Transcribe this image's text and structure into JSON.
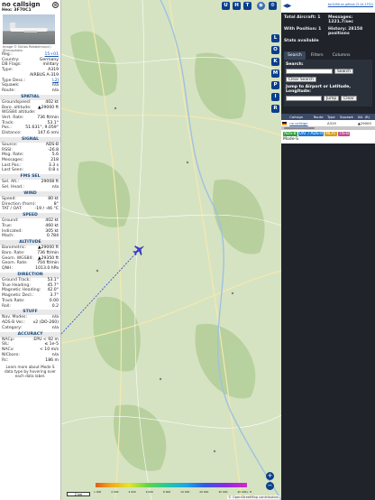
{
  "aircraft": {
    "callsign": "no callsign",
    "hex_label": "Hex:",
    "hex": "3F70C1",
    "photo_credit": "Image © Niclas Rebbelmund / @nrcaphoto",
    "close_symbol": "⊗"
  },
  "info_rows": [
    {
      "k": "Reg.:",
      "v": "15+01",
      "link": true
    },
    {
      "k": "Country:",
      "v": "Germany"
    },
    {
      "k": "DB Flags:",
      "v": "military"
    },
    {
      "k": "Type:",
      "v": "A319"
    },
    {
      "k": "",
      "v": "AIRBUS A-319"
    },
    {
      "k": "Type Desc.:",
      "v": "L2J",
      "link": true
    },
    {
      "k": "Squawk:",
      "v": "n/a"
    },
    {
      "k": "Route:",
      "v": "n/a"
    }
  ],
  "sections": [
    {
      "title": "SPATIAL",
      "rows": [
        {
          "k": "Groundspeed:",
          "v": "402 kt"
        },
        {
          "k": "Baro. altitude:",
          "v": "▲29000 ft"
        },
        {
          "k": "WGS84 altitude:",
          "v": ""
        },
        {
          "k": "Vert. Rate:",
          "v": "736 ft/min"
        },
        {
          "k": "Track:",
          "v": "53.1°"
        },
        {
          "k": "Pos.:",
          "v": "51.631°, 9.059°"
        },
        {
          "k": "Distance:",
          "v": "147.6 nmi"
        }
      ]
    },
    {
      "title": "SIGNAL",
      "rows": [
        {
          "k": "Source:",
          "v": "ADS-B"
        },
        {
          "k": "RSSI:",
          "v": "-26.8"
        },
        {
          "k": "Msg. Rate:",
          "v": "5.6"
        },
        {
          "k": "Messages:",
          "v": "218"
        },
        {
          "k": "Last Pos.:",
          "v": "3.3 s"
        },
        {
          "k": "Last Seen:",
          "v": "0.8 s"
        }
      ]
    },
    {
      "title": "FMS SEL",
      "rows": [
        {
          "k": "Sel. Alt.:",
          "v": "29008 ft"
        },
        {
          "k": "Sel. Head.:",
          "v": "n/a"
        }
      ]
    },
    {
      "title": "WIND",
      "rows": [
        {
          "k": "Speed:",
          "v": "80 kt"
        },
        {
          "k": "Direction (from):",
          "v": "8°"
        },
        {
          "k": "TAT / OAT:",
          "v": "-19 / -46 °C"
        }
      ]
    },
    {
      "title": "SPEED",
      "rows": [
        {
          "k": "Ground:",
          "v": "402 kt"
        },
        {
          "k": "True:",
          "v": "460 kt"
        },
        {
          "k": "Indicated:",
          "v": "305 kt"
        },
        {
          "k": "Mach:",
          "v": "0.784"
        }
      ]
    },
    {
      "title": "ALTITUDE",
      "rows": [
        {
          "k": "Barometric:",
          "v": "▲29000 ft"
        },
        {
          "k": "Baro. Rate:",
          "v": "736 ft/min"
        },
        {
          "k": "Geom. WGS84:",
          "v": "▲29350 ft"
        },
        {
          "k": "Geom. Rate:",
          "v": "704 ft/min"
        },
        {
          "k": "QNH:",
          "v": "1013.0 hPa"
        }
      ]
    },
    {
      "title": "DIRECTION",
      "rows": [
        {
          "k": "Ground Track:",
          "v": "53.1°"
        },
        {
          "k": "True Heading:",
          "v": "45.7°"
        },
        {
          "k": "Magnetic Heading:",
          "v": "42.0°"
        },
        {
          "k": "Magnetic Decl.:",
          "v": "3.7°"
        },
        {
          "k": "Track Rate:",
          "v": "0.00"
        },
        {
          "k": "Roll:",
          "v": "0.2"
        }
      ]
    },
    {
      "title": "STUFF",
      "rows": [
        {
          "k": "Nav. Modes:",
          "v": "n/a"
        },
        {
          "k": "ADS-B Ver.:",
          "v": "v2 (DO-260)"
        },
        {
          "k": "Category:",
          "v": "n/a"
        }
      ]
    },
    {
      "title": "ACCURACY",
      "rows": [
        {
          "k": "NACp:",
          "v": "EPU < 92 m"
        },
        {
          "k": "SIL:",
          "v": "≤ 1e-5"
        },
        {
          "k": "NACv:",
          "v": "< 10 m/s"
        },
        {
          "k": "NICbaro:",
          "v": "n/a"
        },
        {
          "k": "Rc:",
          "v": "186 m"
        }
      ]
    }
  ],
  "footer_note": "Learn more about Mode S data type by hovering over each data label.",
  "map": {
    "top_buttons": [
      "U",
      "H",
      "T"
    ],
    "side_buttons": [
      "L",
      "O",
      "K",
      "M",
      "P",
      "I",
      "R"
    ],
    "scale_label": "2 km",
    "altitude_legend": [
      "1 000",
      "2 000",
      "4 000",
      "6 000",
      "8 000",
      "10 000",
      "20 000",
      "30 000",
      "40 000+ ft"
    ],
    "attribution": "© OpenStreetMap contributors",
    "zoom_in": "+",
    "zoom_out": "−"
  },
  "right": {
    "download_link": "tar1090 on github (3.14.1752)",
    "stats": [
      {
        "label": "Total Aircraft: 1",
        "value": "Messages: 1221.7/sec"
      },
      {
        "label": "With Position: 1",
        "value": "History: 28158 positions"
      },
      {
        "label": "Stats available",
        "value": ""
      }
    ],
    "tabs": [
      "Search",
      "Filters",
      "Columns"
    ],
    "search_label": "Search:",
    "search_button": "Search",
    "clear_search": "Clear Search",
    "jump_label": "Jump to Airport or Latitude, Longitude:",
    "jump_button": "Jump",
    "clear_button": "Clear",
    "table_headers": [
      "",
      "Callsign",
      "Route",
      "Type",
      "Squawk",
      "Alt. (ft)"
    ],
    "table_row": {
      "callsign": "no callsign",
      "route": "",
      "type": "A319",
      "squawk": "",
      "alt": "▲29000"
    },
    "badges": [
      {
        "text": "ADS-B",
        "color": "#2e9e3a"
      },
      {
        "text": "UAT / ADS-R",
        "color": "#1c7bd4"
      },
      {
        "text": "MLAT",
        "color": "#d4a017"
      },
      {
        "text": "TIS-B",
        "color": "#c84a8f"
      }
    ],
    "modes_label": "Mode-S"
  }
}
